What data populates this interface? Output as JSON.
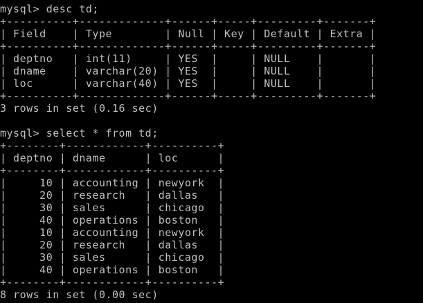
{
  "terminal": {
    "lines": [
      "mysql> desc td;",
      "+----------+-------------+------+-----+---------+-------+",
      "| Field    | Type        | Null | Key | Default | Extra |",
      "+----------+-------------+------+-----+---------+-------+",
      "| deptno   | int(11)     | YES  |     | NULL    |       |",
      "| dname    | varchar(20) | YES  |     | NULL    |       |",
      "| loc      | varchar(40) | YES  |     | NULL    |       |",
      "+----------+-------------+------+-----+---------+-------+",
      "3 rows in set (0.16 sec)",
      "",
      "mysql> select * from td;",
      "+--------+------------+----------+",
      "| deptno | dname      | loc      |",
      "+--------+------------+----------+",
      "|     10 | accounting | newyork  |",
      "|     20 | research   | dallas   |",
      "|     30 | sales      | chicago  |",
      "|     40 | operations | boston   |",
      "|     10 | accounting | newyork  |",
      "|     20 | research   | dallas   |",
      "|     30 | sales      | chicago  |",
      "|     40 | operations | boston   |",
      "+--------+------------+----------+",
      "8 rows in set (0.00 sec)"
    ]
  },
  "colors": {
    "background": "#000000",
    "text": "#c0c0c0"
  }
}
